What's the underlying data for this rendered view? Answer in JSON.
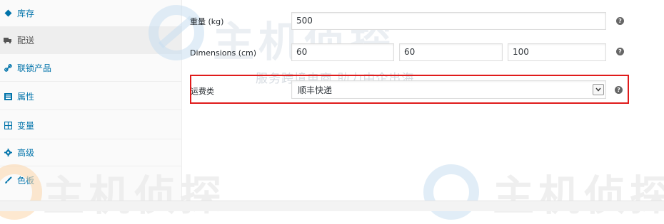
{
  "sidebar": {
    "items": [
      {
        "label": "库存",
        "icon": "tag-icon"
      },
      {
        "label": "配送",
        "icon": "truck-icon"
      },
      {
        "label": "联锁产品",
        "icon": "link-icon"
      },
      {
        "label": "属性",
        "icon": "list-icon"
      },
      {
        "label": "变量",
        "icon": "grid-icon"
      },
      {
        "label": "高级",
        "icon": "gear-icon"
      },
      {
        "label": "色板",
        "icon": "brush-icon"
      }
    ],
    "active_index": 1
  },
  "shipping": {
    "weight": {
      "label": "重量 (kg)",
      "value": "500"
    },
    "dimensions": {
      "label": "Dimensions (cm)",
      "length": "60",
      "width": "60",
      "height": "100"
    },
    "shipping_class": {
      "label": "运费类",
      "value": "顺丰快递"
    },
    "help_glyph": "?"
  },
  "watermark": {
    "brand": "主机侦探",
    "tagline": "服务跨境电商 助力中企出海"
  },
  "colors": {
    "link": "#0073aa",
    "highlight_border": "#e01b1b"
  }
}
